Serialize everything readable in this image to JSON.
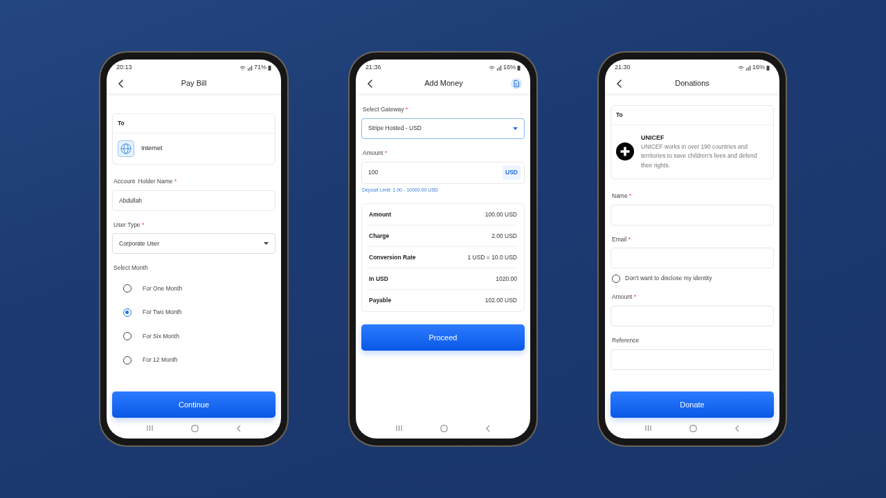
{
  "phones": [
    {
      "status_bar": {
        "time": "20:13",
        "battery": "71%"
      },
      "title": "Pay Bill",
      "header_action": false,
      "blocks": [
        {
          "kind": "recipient",
          "heading": "To",
          "name": "Internet"
        },
        {
          "kind": "field",
          "label": "Account  Holder Name",
          "required_mark": "*",
          "value": "Abdullah"
        },
        {
          "kind": "select",
          "label": "User Type",
          "required_mark": "*",
          "value": "Corporate User",
          "focused": false
        },
        {
          "kind": "radio_group",
          "label": "Select Month",
          "options": [
            {
              "label": "For One Month",
              "selected": false
            },
            {
              "label": "For Two Month",
              "selected": true
            },
            {
              "label": "For Six Month",
              "selected": false
            },
            {
              "label": "For 12 Month",
              "selected": false
            }
          ]
        }
      ],
      "button": "Continue"
    },
    {
      "status_bar": {
        "time": "21:36",
        "battery": "16%"
      },
      "title": "Add Money",
      "header_action": true,
      "blocks": [
        {
          "kind": "select",
          "label": "Select Gateway",
          "required_mark": "*",
          "value": "Stripe Hosted - USD",
          "focused": true
        },
        {
          "kind": "field",
          "label": "Amount",
          "required_mark": "*",
          "value": "100",
          "suffix": "USD",
          "hint": "Deposit Limit: 1.00 - 10000.00 USD"
        },
        {
          "kind": "summary",
          "rows": [
            {
              "label": "Amount",
              "value": "100.00 USD"
            },
            {
              "label": "Charge",
              "value": "2.00 USD"
            },
            {
              "label": "Conversion Rate",
              "value": "1 USD = 10.0 USD"
            },
            {
              "label": "In USD",
              "value": "1020.00"
            },
            {
              "label": "Payable",
              "value": "102.00 USD"
            }
          ]
        }
      ],
      "button": "Proceed"
    },
    {
      "status_bar": {
        "time": "21:30",
        "battery": "16%"
      },
      "title": "Donations",
      "header_action": false,
      "blocks": [
        {
          "kind": "recipient",
          "heading": "To",
          "name": "UNICEF",
          "description": "UNICEF works in over 190 countries and territories to save children's lives and defend their rights."
        },
        {
          "kind": "field",
          "label": "Name",
          "required_mark": "*"
        },
        {
          "kind": "field",
          "label": "Email",
          "required_mark": "*"
        },
        {
          "kind": "check",
          "label": "Don't want to disclose my identity",
          "checked": false
        },
        {
          "kind": "field",
          "label": "Amount",
          "required_mark": "*"
        },
        {
          "kind": "field",
          "label": "Reference"
        }
      ],
      "button": "Donate"
    }
  ]
}
